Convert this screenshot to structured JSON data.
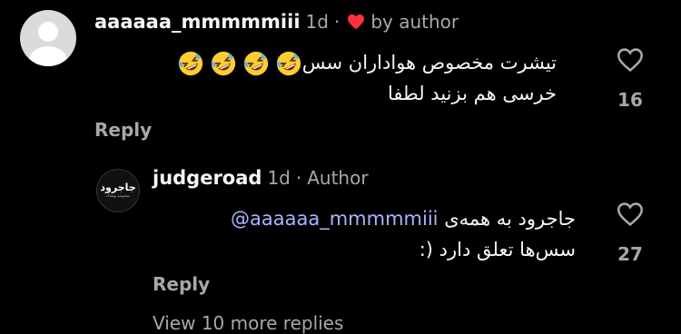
{
  "comment": {
    "username": "aaaaaa_mmmmmiii",
    "time": "1d",
    "separator": "·",
    "liked_by_author": "by author",
    "text_line1": "تیشرت مخصوص هواداران سس",
    "text_line2": "خرسی هم بزنید لطفا",
    "emoji_name": "rolling-on-floor-laughing",
    "emoji_count": 4,
    "reply_label": "Reply",
    "like_count": "16"
  },
  "reply": {
    "username": "judgeroad",
    "time": "1d",
    "separator": "·",
    "badge": "Author",
    "avatar_word": "جاجرود",
    "avatar_sub": "مجموعه پوشاک",
    "mention": "@aaaaaa_mmmmmiii",
    "text_line1_rest": " جاجرود به همه‌ی",
    "text_line2": "سس‌ها تعلق دارد (:",
    "reply_label": "Reply",
    "like_count": "27"
  },
  "view_replies_partial": "View 10 more replies",
  "colors": {
    "background": "#000000",
    "text": "#f5f5f5",
    "muted": "#a8a8a8",
    "heart_red": "#ff3040",
    "mention_blue": "#a7b6ff"
  },
  "icons": [
    "user-silhouette-icon",
    "heart-filled-icon",
    "heart-outline-icon",
    "laughing-emoji-icon"
  ]
}
